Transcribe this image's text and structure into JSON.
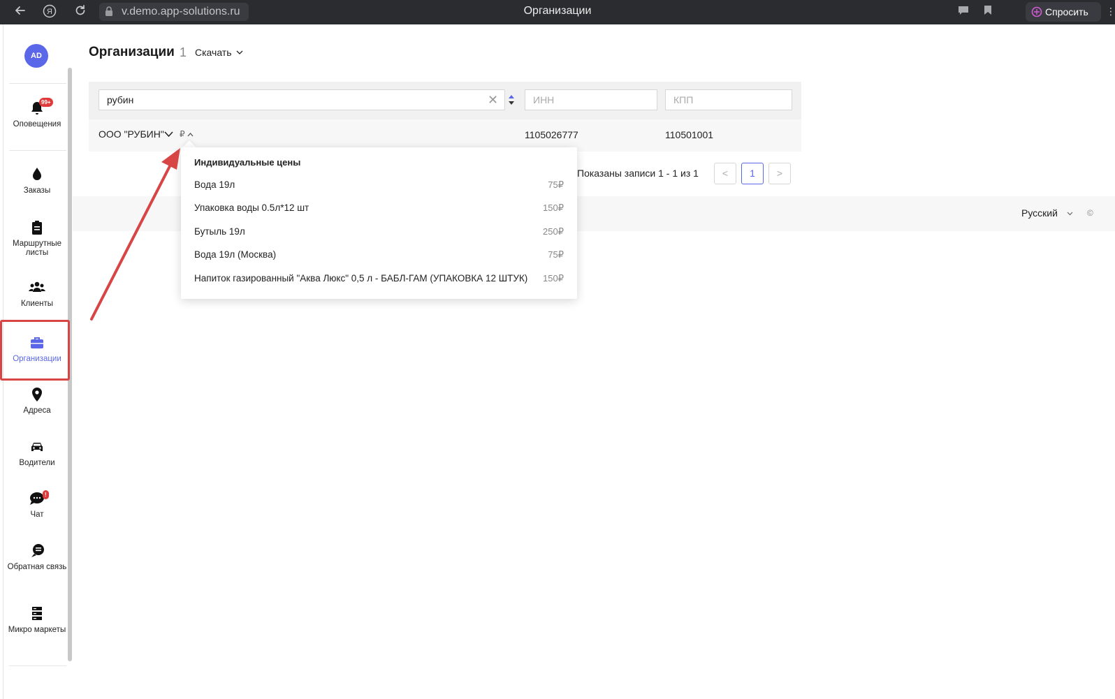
{
  "browser": {
    "url": "v.demo.app-solutions.ru",
    "tab_title": "Организации",
    "ask_label": "Спросить",
    "ya_label": "Я"
  },
  "sidebar": {
    "avatar_initials": "AD",
    "items": [
      {
        "label": "Оповещения",
        "badge": "99+"
      },
      {
        "label": "Заказы"
      },
      {
        "label": "Маршрутные листы"
      },
      {
        "label": "Клиенты"
      },
      {
        "label": "Организации",
        "active": true
      },
      {
        "label": "Адреса"
      },
      {
        "label": "Водители"
      },
      {
        "label": "Чат",
        "badge": "!"
      },
      {
        "label": "Обратная связь"
      },
      {
        "label": "Микро маркеты"
      }
    ]
  },
  "header": {
    "title": "Организации",
    "count": "1",
    "download_label": "Скачать"
  },
  "filters": {
    "search_value": "рубин",
    "inn_placeholder": "ИНН",
    "kpp_placeholder": "КПП"
  },
  "table": {
    "rows": [
      {
        "name": "ООО \"РУБИН\"",
        "inn": "1105026777",
        "kpp": "110501001",
        "price_icon": "₽"
      }
    ]
  },
  "pagination": {
    "info": "Показаны записи 1 - 1 из 1",
    "current_page": "1",
    "prev": "<",
    "next": ">"
  },
  "popover": {
    "title": "Индивидуальные цены",
    "items": [
      {
        "name": "Вода 19л",
        "price": "75₽"
      },
      {
        "name": "Упаковка воды 0.5л*12 шт",
        "price": "150₽"
      },
      {
        "name": "Бутыль 19л",
        "price": "250₽"
      },
      {
        "name": "Вода 19л (Москва)",
        "price": "75₽"
      },
      {
        "name": "Напиток газированный \"Аква Люкс\" 0,5 л - БАБЛ-ГАМ (УПАКОВКА 12 ШТУК)",
        "price": "150₽"
      }
    ]
  },
  "footer": {
    "language": "Русский",
    "copyright": "©"
  },
  "colors": {
    "accent": "#5a67e8",
    "annotation": "#d84545",
    "badge": "#e03a3a"
  }
}
